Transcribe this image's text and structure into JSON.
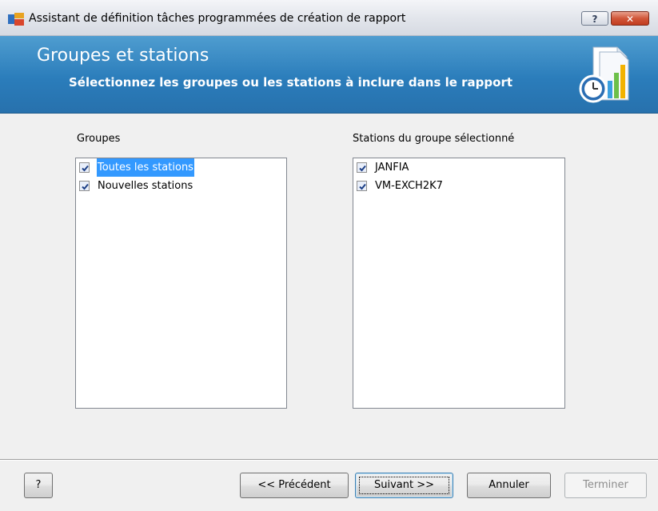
{
  "window": {
    "title": "Assistant de définition tâches programmées de création de rapport",
    "help_label": "?",
    "close_label": "✕"
  },
  "header": {
    "title": "Groupes et stations",
    "subtitle": "Sélectionnez les groupes ou les stations à inclure dans le rapport"
  },
  "groups": {
    "label": "Groupes",
    "items": [
      {
        "label": "Toutes les stations",
        "checked": true,
        "selected": true
      },
      {
        "label": "Nouvelles stations",
        "checked": true,
        "selected": false
      }
    ]
  },
  "stations": {
    "label": "Stations du groupe sélectionné",
    "items": [
      {
        "label": "JANFIA",
        "checked": true
      },
      {
        "label": "VM-EXCH2K7",
        "checked": true
      }
    ]
  },
  "footer": {
    "help_label": "?",
    "previous_label": "<< Précédent",
    "next_label": "Suivant >>",
    "cancel_label": "Annuler",
    "finish_label": "Terminer"
  },
  "colors": {
    "banner": "#2b7dbb",
    "selection": "#3399ff"
  }
}
